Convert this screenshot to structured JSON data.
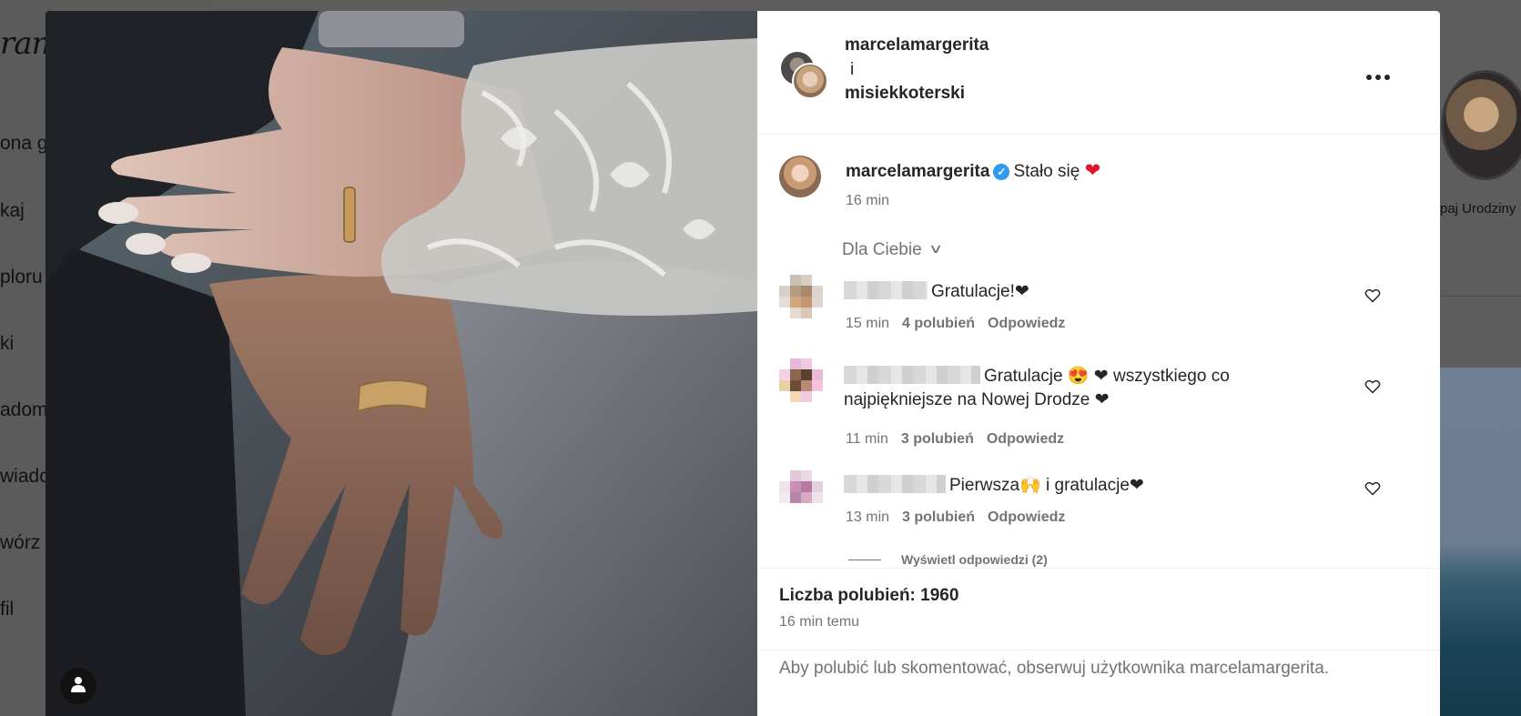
{
  "background": {
    "logo_fragment": "ram",
    "nav_fragments": [
      "ona g",
      "kaj",
      "ploru",
      "ki",
      "adom",
      "wiado",
      "wórz",
      "fil"
    ],
    "story_label_fragment": "paj Urodziny"
  },
  "post_header": {
    "user1": "marcelamargerita",
    "conjunction": "i",
    "user2": "misiekkoterski",
    "more_icon": "more-horizontal-icon"
  },
  "caption": {
    "username": "marcelamargerita",
    "verified_icon": "verified-badge-icon",
    "text": "Stało się",
    "emoji": "❤",
    "time": "16 min"
  },
  "comment_filter": {
    "label": "Dla Ciebie",
    "icon": "chevron-down-icon"
  },
  "comments": [
    {
      "text": "Gratulacje!❤",
      "time": "15 min",
      "likes": "4 polubień",
      "reply": "Odpowiedz"
    },
    {
      "text": "Gratulacje 😍 ❤ wszystkiego co najpiękniejsze na Nowej Drodze ❤",
      "time": "11 min",
      "likes": "3 polubień",
      "reply": "Odpowiedz"
    },
    {
      "text": "Pierwsza🙌 i gratulacje❤",
      "time": "13 min",
      "likes": "3 polubień",
      "reply": "Odpowiedz"
    }
  ],
  "view_replies": "Wyświetl odpowiedzi (2)",
  "likes_count": "Liczba polubień: 1960",
  "post_time": "16 min temu",
  "footer_note": "Aby polubić lub skomentować, obserwuj użytkownika marcelamargerita.",
  "colors": {
    "accent_verified": "#2f9bf0",
    "heart": "#e3142d",
    "muted_text": "#737373"
  }
}
